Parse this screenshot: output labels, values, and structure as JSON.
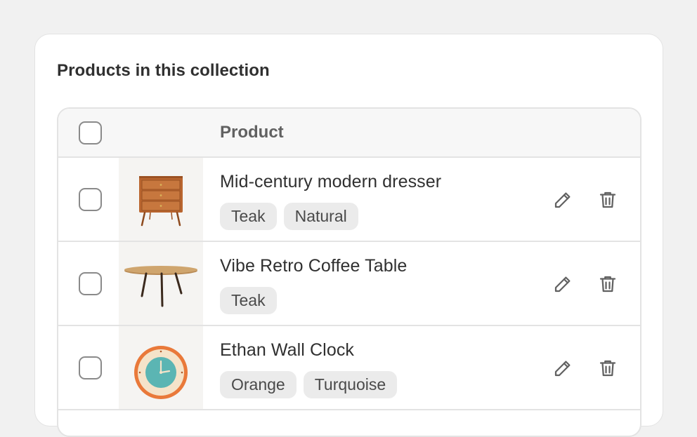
{
  "card": {
    "title": "Products in this collection"
  },
  "table": {
    "header": {
      "product_label": "Product"
    },
    "rows": [
      {
        "name": "Mid-century modern dresser",
        "tags": [
          "Teak",
          "Natural"
        ],
        "image": "dresser"
      },
      {
        "name": "Vibe Retro Coffee Table",
        "tags": [
          "Teak"
        ],
        "image": "coffee-table"
      },
      {
        "name": "Ethan Wall Clock",
        "tags": [
          "Orange",
          "Turquoise"
        ],
        "image": "wall-clock"
      }
    ]
  },
  "icons": {
    "edit": "pencil-icon",
    "delete": "trash-icon"
  },
  "colors": {
    "background": "#f1f1f1",
    "card": "#ffffff",
    "border": "#e3e3e3",
    "tag_bg": "#ebebeb",
    "icon": "#616161"
  }
}
